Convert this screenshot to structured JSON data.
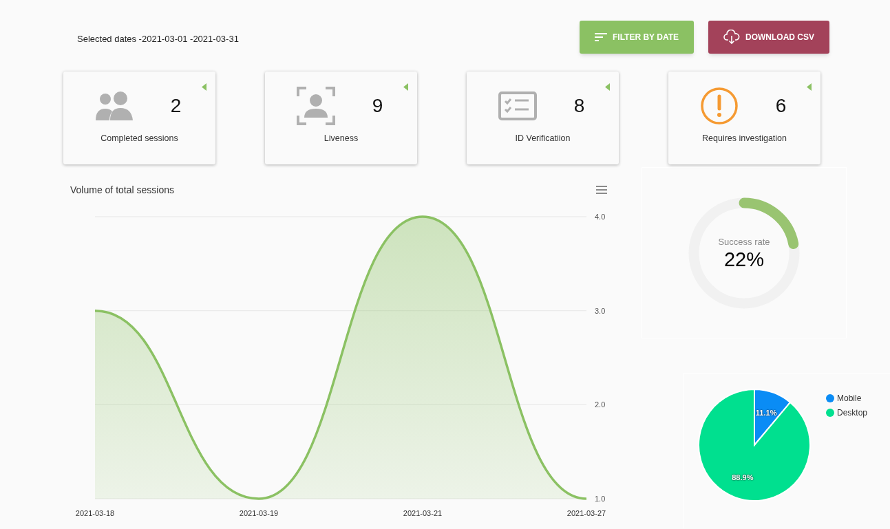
{
  "selected_dates": "Selected dates -2021-03-01 -2021-03-31",
  "buttons": [
    {
      "kind": "filter",
      "label": "FILTER BY DATE"
    },
    {
      "kind": "download",
      "label": "DOWNLOAD CSV"
    }
  ],
  "stats": [
    {
      "kind": "people",
      "value": "2",
      "label": "Completed sessions"
    },
    {
      "kind": "face",
      "value": "9",
      "label": "Liveness"
    },
    {
      "kind": "checklist",
      "value": "8",
      "label": "ID Verificatiion"
    },
    {
      "kind": "alert",
      "value": "6",
      "label": "Requires investigation"
    }
  ],
  "volume_chart": {
    "chart_data": {
      "type": "area",
      "title": "Volume of total sessions",
      "categories": [
        "2021-03-18",
        "2021-03-19",
        "2021-03-21",
        "2021-03-27"
      ],
      "series": [
        {
          "color": "#8bc163",
          "values": [
            3,
            1,
            4,
            1
          ]
        }
      ],
      "ylim": [
        1,
        4
      ],
      "yticks": [
        {
          "value": 1,
          "label": "1.0"
        },
        {
          "value": 2,
          "label": "2.0"
        },
        {
          "value": 3,
          "label": "3.0"
        },
        {
          "value": 4,
          "label": "4.0"
        }
      ]
    }
  },
  "success_rate": {
    "label": "Success rate",
    "value": "22%",
    "level": 0.22
  },
  "device_chart": {
    "chart_data": {
      "type": "pie",
      "categories": [
        "Mobile",
        "Desktop"
      ],
      "values": [
        11.1,
        88.9
      ],
      "colors": [
        "#0a8cf5",
        "#00e08f"
      ],
      "value_labels": [
        "11.1%",
        "88.9%"
      ]
    }
  }
}
